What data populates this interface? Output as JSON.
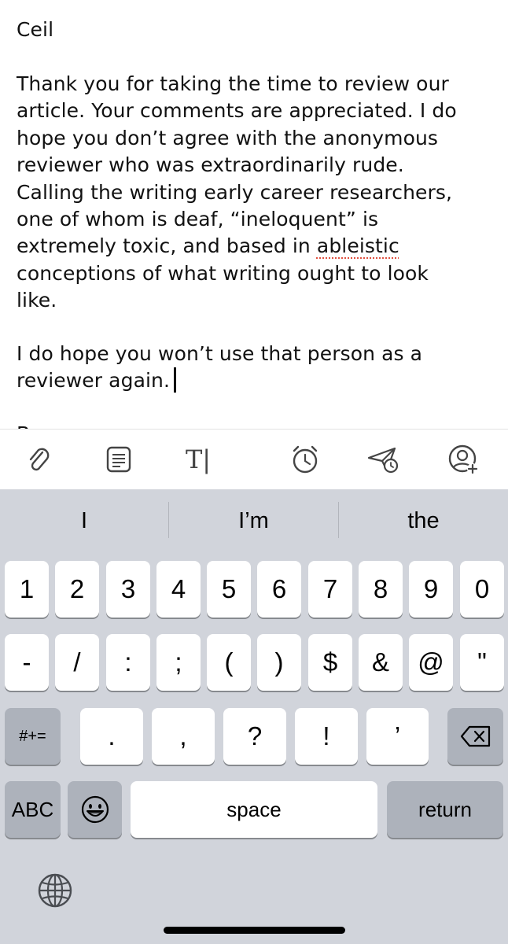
{
  "compose": {
    "greeting": "Ceil",
    "paragraph1_lines": [
      "Thank you for taking the time to review our",
      "article. Your comments are appreciated. I do",
      "hope you don’t agree with the anonymous",
      "reviewer who was extraordinarily rude.",
      "Calling the writing early career researchers,",
      "one of whom is deaf, “ineloquent” is"
    ],
    "paragraph1_line7_before": "extremely toxic, and based in ",
    "paragraph1_misspelled_word": "ableistic",
    "paragraph1_tail_lines": [
      "conceptions of what writing ought to look",
      "like."
    ],
    "paragraph2_lines": [
      "I do hope you won’t use that person as a"
    ],
    "paragraph2_last_line": "reviewer again.",
    "next_line_peek": "B"
  },
  "toolbar": {
    "icons": [
      "paperclip-icon",
      "document-icon",
      "text-format-icon",
      "alarm-clock-icon",
      "send-later-icon",
      "add-contact-icon"
    ],
    "text_format_glyph": "T|"
  },
  "keyboard": {
    "suggestions": [
      "I",
      "I’m",
      "the"
    ],
    "row1": [
      "1",
      "2",
      "3",
      "4",
      "5",
      "6",
      "7",
      "8",
      "9",
      "0"
    ],
    "row2": [
      "-",
      "/",
      ":",
      ";",
      "(",
      ")",
      "$",
      "&",
      "@",
      "\""
    ],
    "row3_mode_key": "#+=",
    "row3_punct": [
      ".",
      ",",
      "?",
      "!",
      "’"
    ],
    "abc_key": "ABC",
    "space_key": "space",
    "return_key": "return"
  },
  "colors": {
    "keyboard_bg": "#d1d4db",
    "key_light": "#ffffff",
    "key_dark": "#adb2bb",
    "spellcheck_underline": "#e0503f"
  }
}
